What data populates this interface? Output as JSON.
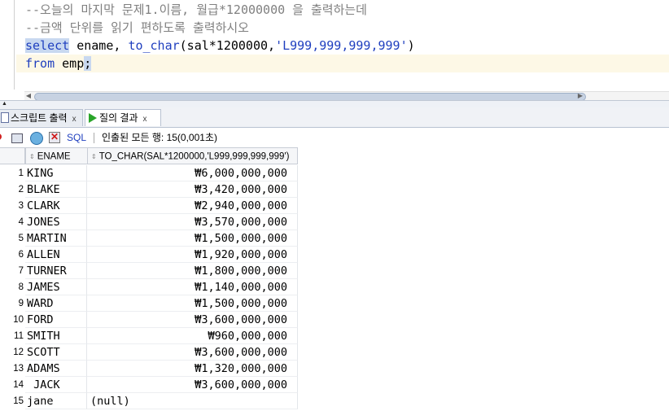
{
  "editor": {
    "line1": "--오늘의 마지막 문제1.이름, 월급*12000000 을 출력하는데",
    "line2": "--금액 단위를 읽기 편하도록 출력하시오",
    "line3": {
      "kw_select": "select",
      "part1": " ename, ",
      "fn": "to_char",
      "part2": "(sal*1200000,",
      "str": "'L999,999,999,999'",
      "part3": ")"
    },
    "line4": {
      "kw_from": "from",
      "part1": " emp",
      "semicolon": ";"
    }
  },
  "tabs": [
    {
      "label": "스크립트 출력",
      "close": "x"
    },
    {
      "label": "질의 결과",
      "close": "x"
    }
  ],
  "toolbar": {
    "sql_label": "SQL",
    "separator": "|",
    "status": "인출된 모든 행: 15(0,001초)"
  },
  "grid": {
    "columns": [
      "ENAME",
      "TO_CHAR(SAL*1200000,'L999,999,999,999')"
    ],
    "rows": [
      {
        "n": "1",
        "ename": "KING",
        "val": "₩6,000,000,000"
      },
      {
        "n": "2",
        "ename": "BLAKE",
        "val": "₩3,420,000,000"
      },
      {
        "n": "3",
        "ename": "CLARK",
        "val": "₩2,940,000,000"
      },
      {
        "n": "4",
        "ename": "JONES",
        "val": "₩3,570,000,000"
      },
      {
        "n": "5",
        "ename": "MARTIN",
        "val": "₩1,500,000,000"
      },
      {
        "n": "6",
        "ename": "ALLEN",
        "val": "₩1,920,000,000"
      },
      {
        "n": "7",
        "ename": "TURNER",
        "val": "₩1,800,000,000"
      },
      {
        "n": "8",
        "ename": "JAMES",
        "val": "₩1,140,000,000"
      },
      {
        "n": "9",
        "ename": "WARD",
        "val": "₩1,500,000,000"
      },
      {
        "n": "10",
        "ename": "FORD",
        "val": "₩3,600,000,000"
      },
      {
        "n": "11",
        "ename": "SMITH",
        "val": "₩960,000,000"
      },
      {
        "n": "12",
        "ename": "SCOTT",
        "val": "₩3,600,000,000"
      },
      {
        "n": "13",
        "ename": "ADAMS",
        "val": "₩1,320,000,000"
      },
      {
        "n": "14",
        "ename": " JACK",
        "val": "₩3,600,000,000"
      },
      {
        "n": "15",
        "ename": "jane",
        "val": "(null)"
      }
    ]
  }
}
